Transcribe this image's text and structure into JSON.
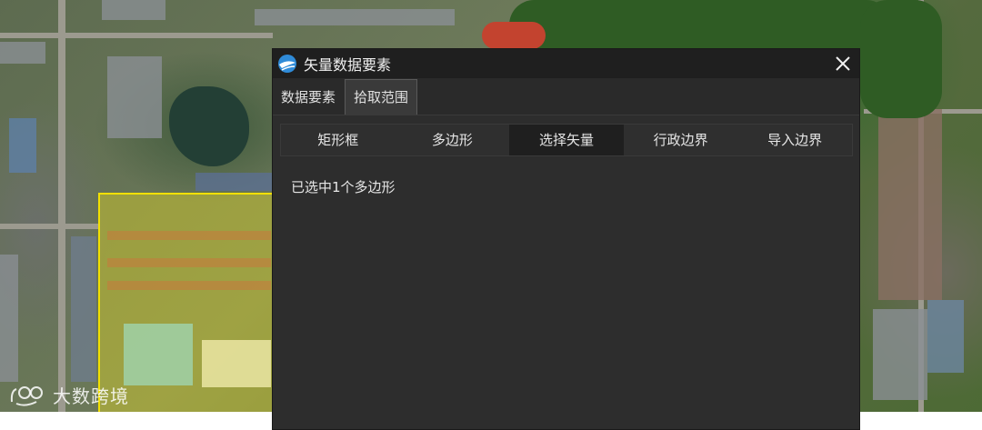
{
  "dialog": {
    "title": "矢量数据要素",
    "tabs": [
      {
        "label": "数据要素",
        "active": false
      },
      {
        "label": "拾取范围",
        "active": true
      }
    ],
    "subtabs": [
      {
        "label": "矩形框",
        "active": false
      },
      {
        "label": "多边形",
        "active": false
      },
      {
        "label": "选择矢量",
        "active": true
      },
      {
        "label": "行政边界",
        "active": false
      },
      {
        "label": "导入边界",
        "active": false
      }
    ],
    "status_text": "已选中1个多边形",
    "icons": {
      "app": "app-logo-icon",
      "close": "close-icon"
    }
  },
  "map": {
    "selection_color": "#f2e000"
  },
  "watermark": {
    "text": "大数跨境"
  },
  "colors": {
    "dialog_bg": "#2d2d2d",
    "titlebar_bg": "#1f1f1f",
    "active_subtab_bg": "#1f1f1f",
    "accent_icon": "#2f8bd8"
  }
}
